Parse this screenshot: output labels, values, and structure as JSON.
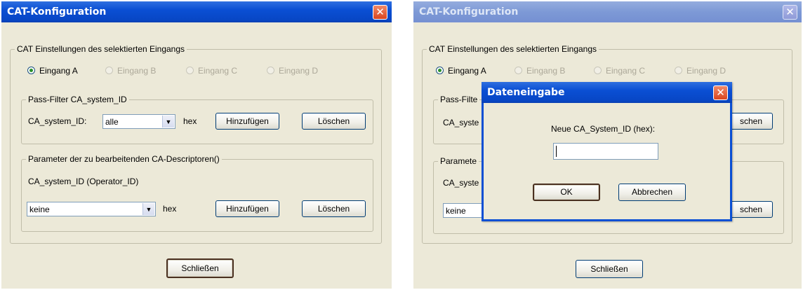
{
  "left_window": {
    "title": "CAT-Konfiguration",
    "close_glyph": "✕",
    "group_cat": {
      "legend": "CAT Einstellungen des selektierten Eingangs",
      "radios": [
        "Eingang A",
        "Eingang B",
        "Eingang C",
        "Eingang D"
      ],
      "selected": "Eingang A"
    },
    "group_pass": {
      "legend": "Pass-Filter CA_system_ID",
      "field_label": "CA_system_ID:",
      "combo_value": "alle",
      "unit": "hex",
      "add_label": "Hinzufügen",
      "delete_label": "Löschen"
    },
    "group_param": {
      "legend": "Parameter der zu bearbeitenden CA-Descriptoren()",
      "field_label": "CA_system_ID (Operator_ID)",
      "combo_value": "keine",
      "unit": "hex",
      "add_label": "Hinzufügen",
      "delete_label": "Löschen"
    },
    "close_label": "Schließen"
  },
  "right_window": {
    "title": "CAT-Konfiguration",
    "close_glyph": "✕",
    "group_cat_legend": "CAT Einstellungen des selektierten Eingangs",
    "radios": [
      "Eingang A",
      "Eingang B",
      "Eingang C",
      "Eingang D"
    ],
    "pass_legend_partial": "Pass-Filte",
    "pass_label_partial": "CA_syste",
    "pass_delete_partial": "schen",
    "param_legend_partial": "Paramete",
    "param_label_partial": "CA_syste",
    "param_combo_value": "keine",
    "param_delete_partial": "schen",
    "close_label": "Schließen"
  },
  "dialog": {
    "title": "Dateneingabe",
    "close_glyph": "✕",
    "prompt": "Neue CA_System_ID (hex):",
    "input_value": "",
    "ok_label": "OK",
    "cancel_label": "Abbrechen"
  },
  "icons": {
    "combo_arrow": "▼"
  }
}
